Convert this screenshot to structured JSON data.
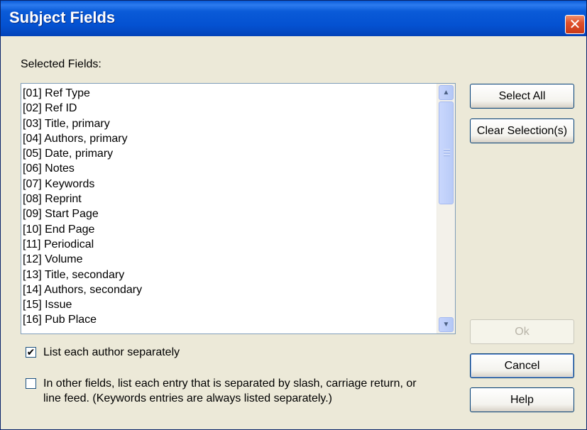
{
  "window": {
    "title": "Subject Fields",
    "close_label": "✕"
  },
  "list": {
    "label": "Selected Fields:",
    "items": [
      "[01] Ref Type",
      "[02] Ref ID",
      "[03] Title, primary",
      "[04] Authors, primary",
      "[05] Date, primary",
      "[06] Notes",
      "[07] Keywords",
      "[08] Reprint",
      "[09] Start Page",
      "[10] End Page",
      "[11] Periodical",
      "[12] Volume",
      "[13] Title, secondary",
      "[14] Authors, secondary",
      "[15] Issue",
      "[16] Pub Place"
    ]
  },
  "buttons": {
    "select_all": "Select All",
    "clear_selection": "Clear Selection(s)",
    "ok": "Ok",
    "cancel": "Cancel",
    "help": "Help"
  },
  "options": {
    "list_authors": {
      "label": "List each author separately",
      "checked": true,
      "mark": "✔"
    },
    "other_fields": {
      "label_line1": "In other fields, list each entry that is separated by slash, carriage return, or",
      "label_line2": "line feed. (Keywords entries are always listed separately.)",
      "checked": false
    }
  }
}
